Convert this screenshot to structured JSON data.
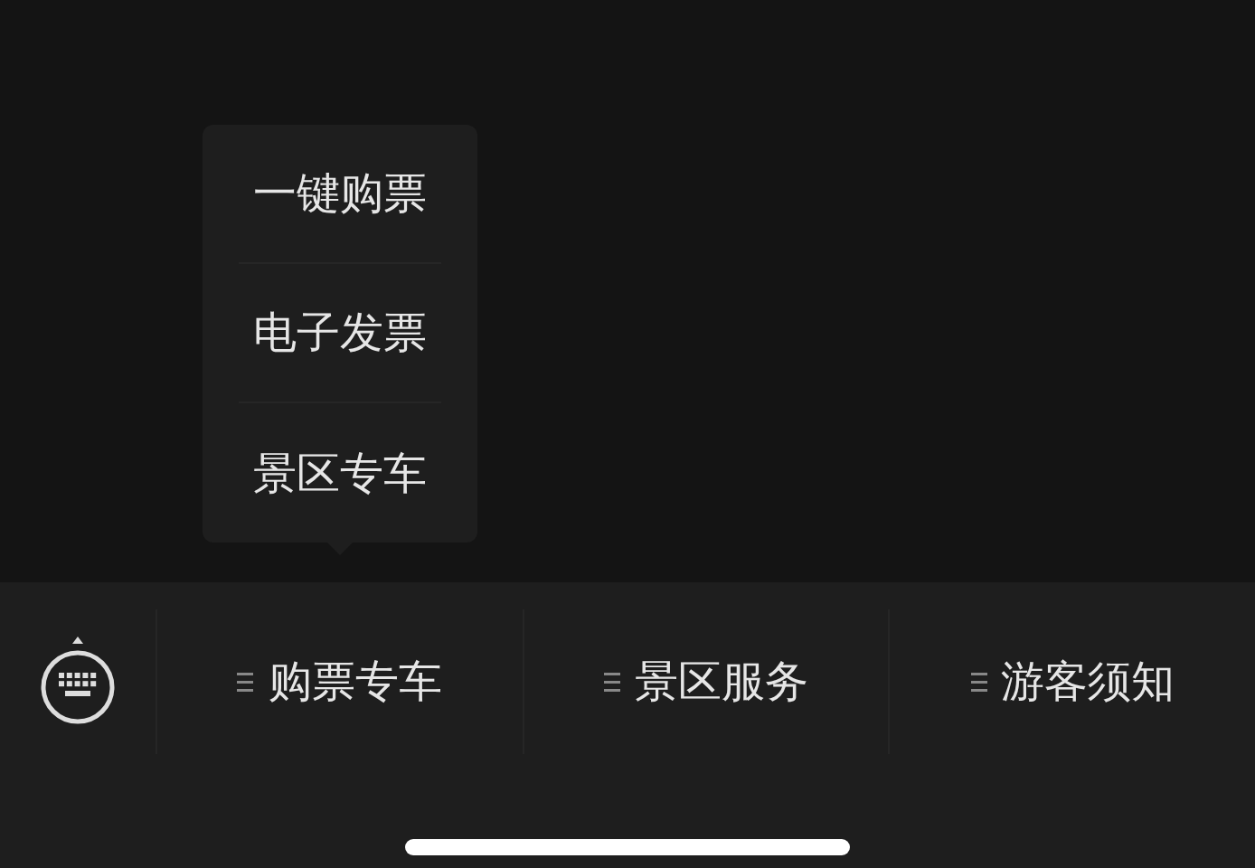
{
  "menus": [
    {
      "label": "购票专车",
      "expanded": true,
      "items": [
        "一键购票",
        "电子发票",
        "景区专车"
      ]
    },
    {
      "label": "景区服务",
      "expanded": false
    },
    {
      "label": "游客须知",
      "expanded": false
    }
  ]
}
